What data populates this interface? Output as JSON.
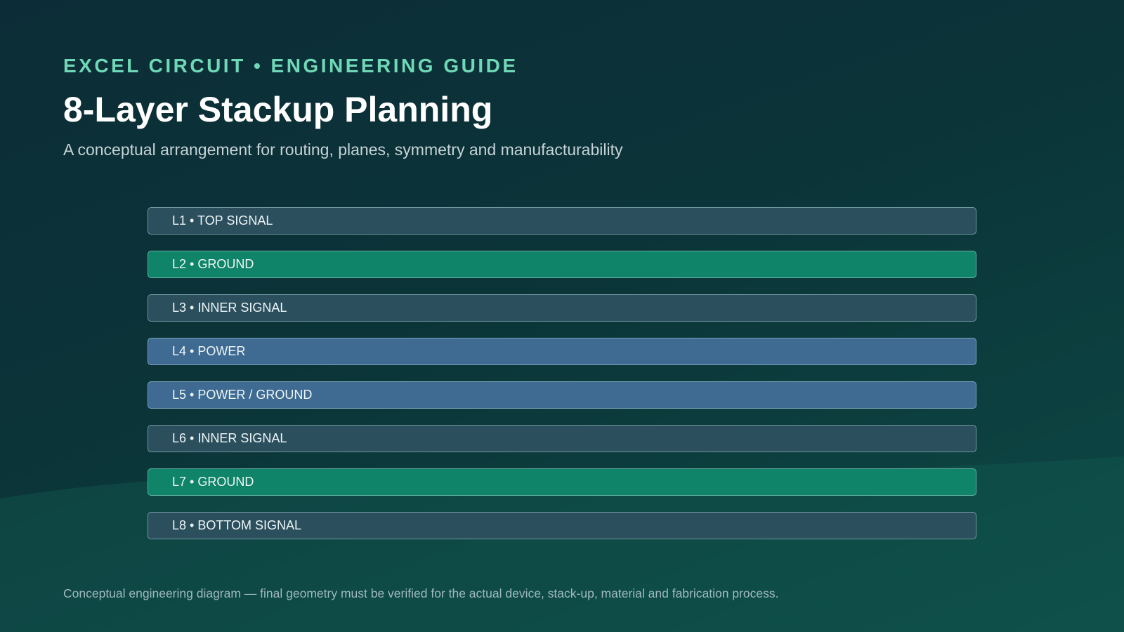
{
  "header": {
    "eyebrow": "EXCEL CIRCUIT • ENGINEERING GUIDE",
    "title": "8-Layer Stackup Planning",
    "subtitle": "A conceptual arrangement for routing, planes, symmetry and manufacturability"
  },
  "colors": {
    "signal": "#2c4f5e",
    "ground": "#0f8468",
    "power": "#3f6a92",
    "accent": "#6fd9b7"
  },
  "stack": {
    "layers": [
      {
        "label": "L1 • TOP SIGNAL",
        "kind": "signal"
      },
      {
        "label": "L2 • GROUND",
        "kind": "ground"
      },
      {
        "label": "L3 • INNER SIGNAL",
        "kind": "signal"
      },
      {
        "label": "L4 • POWER",
        "kind": "power"
      },
      {
        "label": "L5 • POWER / GROUND",
        "kind": "power"
      },
      {
        "label": "L6 • INNER SIGNAL",
        "kind": "signal"
      },
      {
        "label": "L7 • GROUND",
        "kind": "ground"
      },
      {
        "label": "L8 • BOTTOM SIGNAL",
        "kind": "signal"
      }
    ]
  },
  "footer": {
    "note": "Conceptual engineering diagram — final geometry must be verified for the actual device, stack-up, material and fabrication process."
  }
}
